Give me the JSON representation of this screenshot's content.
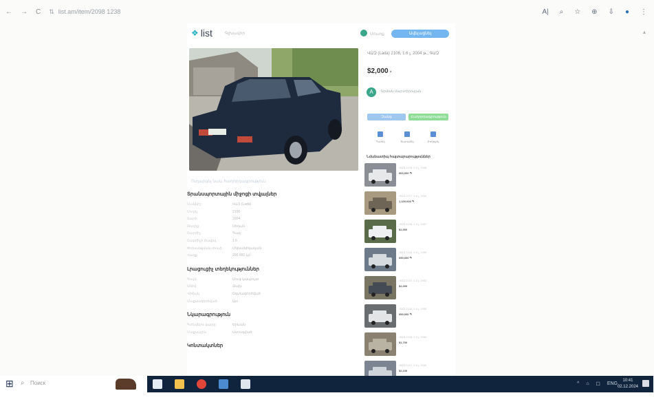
{
  "browser": {
    "url": "list.am/item/2098 1238",
    "nav": [
      "←",
      "→",
      "C"
    ],
    "tools": [
      "A|",
      "⌕",
      "☆",
      "⊕",
      "⇩",
      "●",
      "⋮"
    ]
  },
  "page": {
    "logo": "list",
    "header_link": "Գլխավոր",
    "account_link": "Մուտք",
    "post_button": "Ավելացնել հայտարարություն",
    "photo_caption": "Ուղարկել նաև հաղորդագրություն",
    "title": "ՎԱԶ (Lada) 2106, 1.6 լ, 2004 թ., ԳԱԶ",
    "price": "$2,000",
    "currency_arrow": "▾",
    "seller_initial": "A",
    "seller_name": "Արման Մարտիրոսյան",
    "call_button": "Զանգ",
    "message_button": "Հաղորդագրություն",
    "actions": [
      "Պահել",
      "Տարածել",
      "Բողոքել"
    ],
    "similar_heading": "Նմանատիպ հայտարարություններ",
    "sections": [
      {
        "title": "Տրանսպորտային միջոցի տվյալներ",
        "rows": [
          [
            "Մակնիշ",
            "ՎԱԶ (Lada)"
          ],
          [
            "Մոդել",
            "2106"
          ],
          [
            "Տարի",
            "2004"
          ],
          [
            "Թափք",
            "Սեդան"
          ],
          [
            "Շարժիչ",
            "Գազ"
          ],
          [
            "Շարժիչի ծավալ",
            "1.6"
          ],
          [
            "Փոխանցման տուփ",
            "Մեխանիկական"
          ],
          [
            "Վազք",
            "200 000 կմ"
          ]
        ]
      },
      {
        "title": "Լրացուցիչ տեղեկություններ",
        "rows": [
          [
            "Գույն",
            "Մուգ կապույտ"
          ],
          [
            "Անիվ",
            "Ձախ"
          ],
          [
            "Վիճակ",
            "Օգտագործված"
          ],
          [
            "Մաքսազերծված",
            "Այո"
          ]
        ]
      },
      {
        "title": "Նկարագրություն",
        "rows": [
          [
            "Գտնվելու վայրը",
            "Երևան"
          ],
          [
            "Մաքսային",
            "Ստուգված"
          ]
        ]
      },
      {
        "title": "Կոնտակտներ",
        "rows": []
      }
    ],
    "similar": [
      {
        "title": "ՎԱԶ 2106, 1.5 լ, 1998",
        "price": "900,000 ֏"
      },
      {
        "title": "ՎԱԶ 2107, 1.6 լ, 2004",
        "price": "1,100,000 ֏"
      },
      {
        "title": "ՎԱԶ 2106, 1.3 լ, 1987",
        "price": "$1,500"
      },
      {
        "title": "ՎԱԶ 2106, 1.5 լ, 1990",
        "price": "650,000 ֏"
      },
      {
        "title": "ՎԱԶ 2107, 1.5 լ, 2002",
        "price": "$2,300"
      },
      {
        "title": "ՎԱԶ 2106, 1.6 լ, 1995",
        "price": "950,000 ֏"
      },
      {
        "title": "ՎԱԶ 2106, 1.3 լ, 1984",
        "price": "$1,700"
      },
      {
        "title": "ՎԱԶ 2107, 1.5 լ, 2000",
        "price": "$2,100"
      }
    ]
  },
  "taskbar": {
    "search_placeholder": "Поиск",
    "tray": [
      "^",
      "⌂",
      "☐",
      "ENG"
    ],
    "time": "10:41",
    "date": "02.12.2024"
  },
  "colors": {
    "accent": "#74b7f0",
    "green": "#8fdc97",
    "taskbar": "#10243d"
  }
}
